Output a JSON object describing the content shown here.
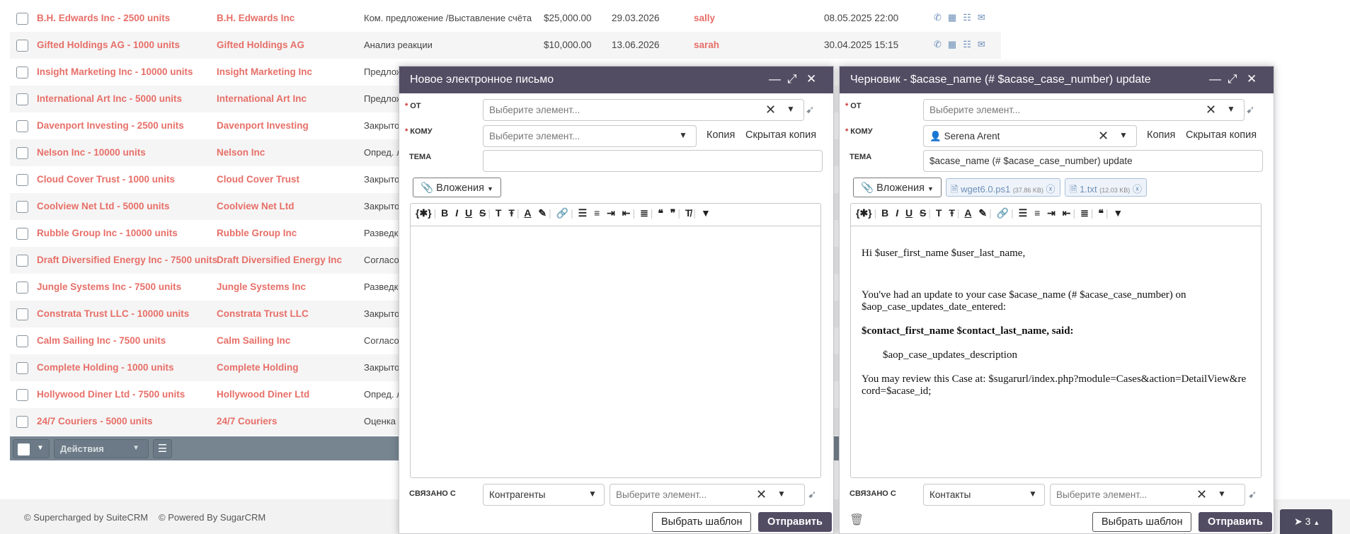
{
  "list": {
    "rows": [
      {
        "name": "B.H. Edwards Inc - 2500 units",
        "account": "B.H. Edwards Inc",
        "stage": "Ком. предложение /Выставление счёта",
        "amount": "$25,000.00",
        "close_date": "29.03.2026",
        "user": "sally",
        "modified": "08.05.2025 22:00"
      },
      {
        "name": "Gifted Holdings AG - 1000 units",
        "account": "Gifted Holdings AG",
        "stage": "Анализ реакции",
        "amount": "$10,000.00",
        "close_date": "13.06.2026",
        "user": "sarah",
        "modified": "30.04.2025 15:15"
      },
      {
        "name": "Insight Marketing Inc - 10000 units",
        "account": "Insight Marketing Inc",
        "stage": "Предлож"
      },
      {
        "name": "International Art Inc - 5000 units",
        "account": "International Art Inc",
        "stage": "Предлож"
      },
      {
        "name": "Davenport Investing - 2500 units",
        "account": "Davenport Investing",
        "stage": "Закрыто"
      },
      {
        "name": "Nelson Inc - 10000 units",
        "account": "Nelson Inc",
        "stage": "Опред. л"
      },
      {
        "name": "Cloud Cover Trust - 1000 units",
        "account": "Cloud Cover Trust",
        "stage": "Закрыто"
      },
      {
        "name": "Coolview Net Ltd - 5000 units",
        "account": "Coolview Net Ltd",
        "stage": "Закрыто"
      },
      {
        "name": "Rubble Group Inc - 10000 units",
        "account": "Rubble Group Inc",
        "stage": "Разведка"
      },
      {
        "name": "Draft Diversified Energy Inc - 7500 units",
        "account": "Draft Diversified Energy Inc",
        "stage": "Согласо"
      },
      {
        "name": "Jungle Systems Inc - 7500 units",
        "account": "Jungle Systems Inc",
        "stage": "Разведка"
      },
      {
        "name": "Constrata Trust LLC - 10000 units",
        "account": "Constrata Trust LLC",
        "stage": "Закрыто"
      },
      {
        "name": "Calm Sailing Inc - 7500 units",
        "account": "Calm Sailing Inc",
        "stage": "Согласо"
      },
      {
        "name": "Complete Holding - 1000 units",
        "account": "Complete Holding",
        "stage": "Закрыто"
      },
      {
        "name": "Hollywood Diner Ltd - 7500 units",
        "account": "Hollywood Diner Ltd",
        "stage": "Опред. л"
      },
      {
        "name": "24/7 Couriers - 5000 units",
        "account": "24/7 Couriers",
        "stage": "Оценка"
      }
    ],
    "action_icons": [
      "phone-icon",
      "calendar-icon",
      "tasks-icon",
      "envelope-icon"
    ],
    "bulk_actions_label": "Действия"
  },
  "footer": {
    "supercharged": "© Supercharged by SuiteCRM",
    "powered": "© Powered By SugarCRM",
    "send_badge": "3"
  },
  "dialog_new": {
    "title": "Новое электронное письмо",
    "from_label": "ОТ",
    "from_placeholder": "Выберите элемент...",
    "to_label": "КОМУ",
    "to_placeholder": "Выберите элемент...",
    "cc_label": "Копия",
    "bcc_label": "Скрытая копия",
    "subject_label": "ТЕМА",
    "subject_value": "",
    "attachments_label": "Вложения",
    "related_label": "СВЯЗАНО С",
    "related_module": "Контрагенты",
    "related_placeholder": "Выберите элемент...",
    "template_button": "Выбрать шаблон",
    "send_button": "Отправить"
  },
  "dialog_draft": {
    "title": "Черновик - $acase_name (# $acase_case_number) update",
    "from_label": "ОТ",
    "from_placeholder": "Выберите элемент...",
    "to_label": "КОМУ",
    "to_value": "Serena Arent",
    "cc_label": "Копия",
    "bcc_label": "Скрытая копия",
    "subject_label": "ТЕМА",
    "subject_value": "$acase_name (# $acase_case_number) update",
    "attachments_label": "Вложения",
    "files": [
      {
        "name": "wget6.0.ps1",
        "size": "(37.86 KB)"
      },
      {
        "name": "1.txt",
        "size": "(12.03 KB)"
      }
    ],
    "body": {
      "greeting": "Hi $user_first_name $user_last_name,",
      "line1": "You've had an update to your case $acase_name (# $acase_case_number) on $aop_case_updates_date_entered:",
      "said": "$contact_first_name $contact_last_name, said:",
      "description": "$aop_case_updates_description",
      "review": "You may review this Case at: $sugarurl/index.php?module=Cases&action=DetailView&record=$acase_id;"
    },
    "related_label": "СВЯЗАНО С",
    "related_module": "Контакты",
    "related_placeholder": "Выберите элемент...",
    "template_button": "Выбрать шаблон",
    "send_button": "Отправить"
  }
}
